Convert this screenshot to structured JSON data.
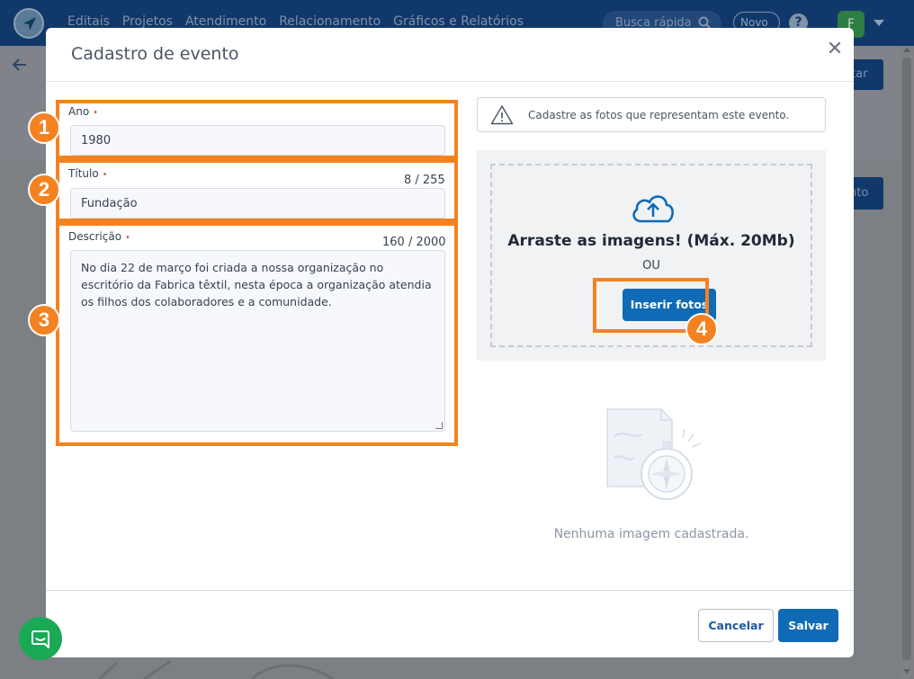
{
  "topbar": {
    "nav": [
      "Editais",
      "Projetos",
      "Atendimento",
      "Relacionamento",
      "Gráficos e Relatórios"
    ],
    "quick_search_placeholder": "Busca rápida",
    "novo_label": "Novo",
    "help_glyph": "?",
    "avatar_initial": "F"
  },
  "background": {
    "button_1_fragment": "tar",
    "button_2_fragment": "nto"
  },
  "modal": {
    "title": "Cadastro de evento",
    "close_glyph": "✕",
    "fields": {
      "ano": {
        "label": "Ano",
        "value": "1980"
      },
      "titulo": {
        "label": "Título",
        "value": "Fundação",
        "counter": "8 / 255"
      },
      "descricao": {
        "label": "Descrição",
        "counter": "160 / 2000",
        "value": "No dia 22 de março foi criada a nossa organização no escritório da Fabrica têxtil, nesta época a organização atendia os filhos dos colaboradores e a comunidade."
      }
    },
    "required_mark": "•",
    "notice_text": "Cadastre as fotos que representam este evento.",
    "upload": {
      "title": "Arraste as imagens! (Máx. 20Mb)",
      "or_text": "OU",
      "button_label": "Inserir fotos"
    },
    "empty_state_text": "Nenhuma imagem cadastrada.",
    "footer": {
      "cancel_label": "Cancelar",
      "save_label": "Salvar"
    }
  },
  "annotations": {
    "badges": [
      "1",
      "2",
      "3",
      "4"
    ],
    "color": "#f58220"
  },
  "colors": {
    "primary": "#0f6bb5",
    "topbar": "#11386a",
    "chat": "#1aaa55"
  }
}
